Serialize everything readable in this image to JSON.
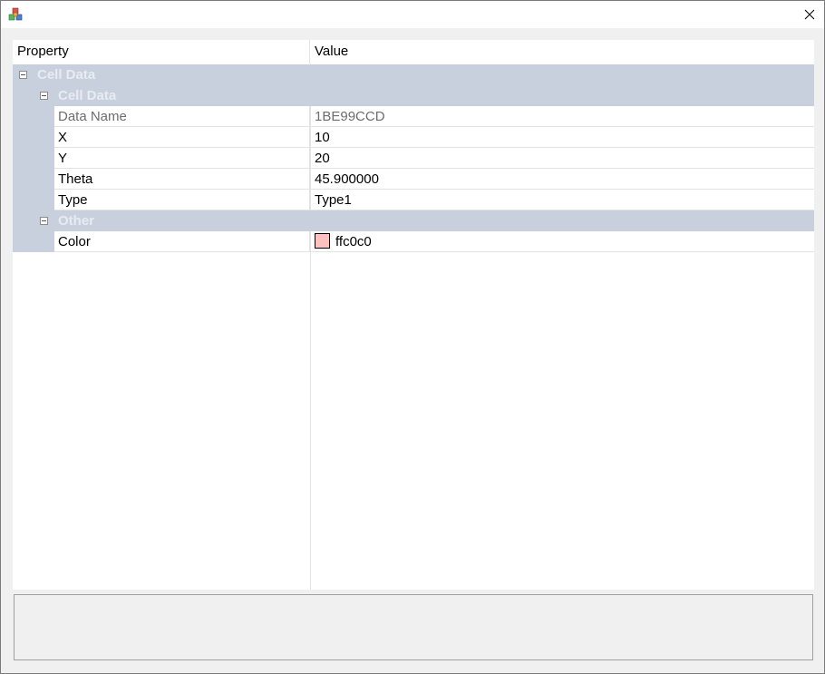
{
  "window": {
    "title": "",
    "close_glyph": "✕"
  },
  "grid": {
    "columns": {
      "property": "Property",
      "value": "Value"
    },
    "root_category": "Cell Data",
    "categories": [
      {
        "name": "Cell Data",
        "properties": [
          {
            "name": "Data Name",
            "value": "1BE99CCD",
            "readonly": true
          },
          {
            "name": "X",
            "value": "10"
          },
          {
            "name": "Y",
            "value": "20"
          },
          {
            "name": "Theta",
            "value": "45.900000"
          },
          {
            "name": "Type",
            "value": "Type1"
          }
        ]
      },
      {
        "name": "Other",
        "properties": [
          {
            "name": "Color",
            "value": "ffc0c0",
            "swatch_color": "#ffc0c0"
          }
        ]
      }
    ]
  },
  "colors": {
    "category_bg": "#c8cfdd",
    "category_text": "#e8ebf2",
    "grid_line": "#e3e3e3"
  },
  "description": ""
}
